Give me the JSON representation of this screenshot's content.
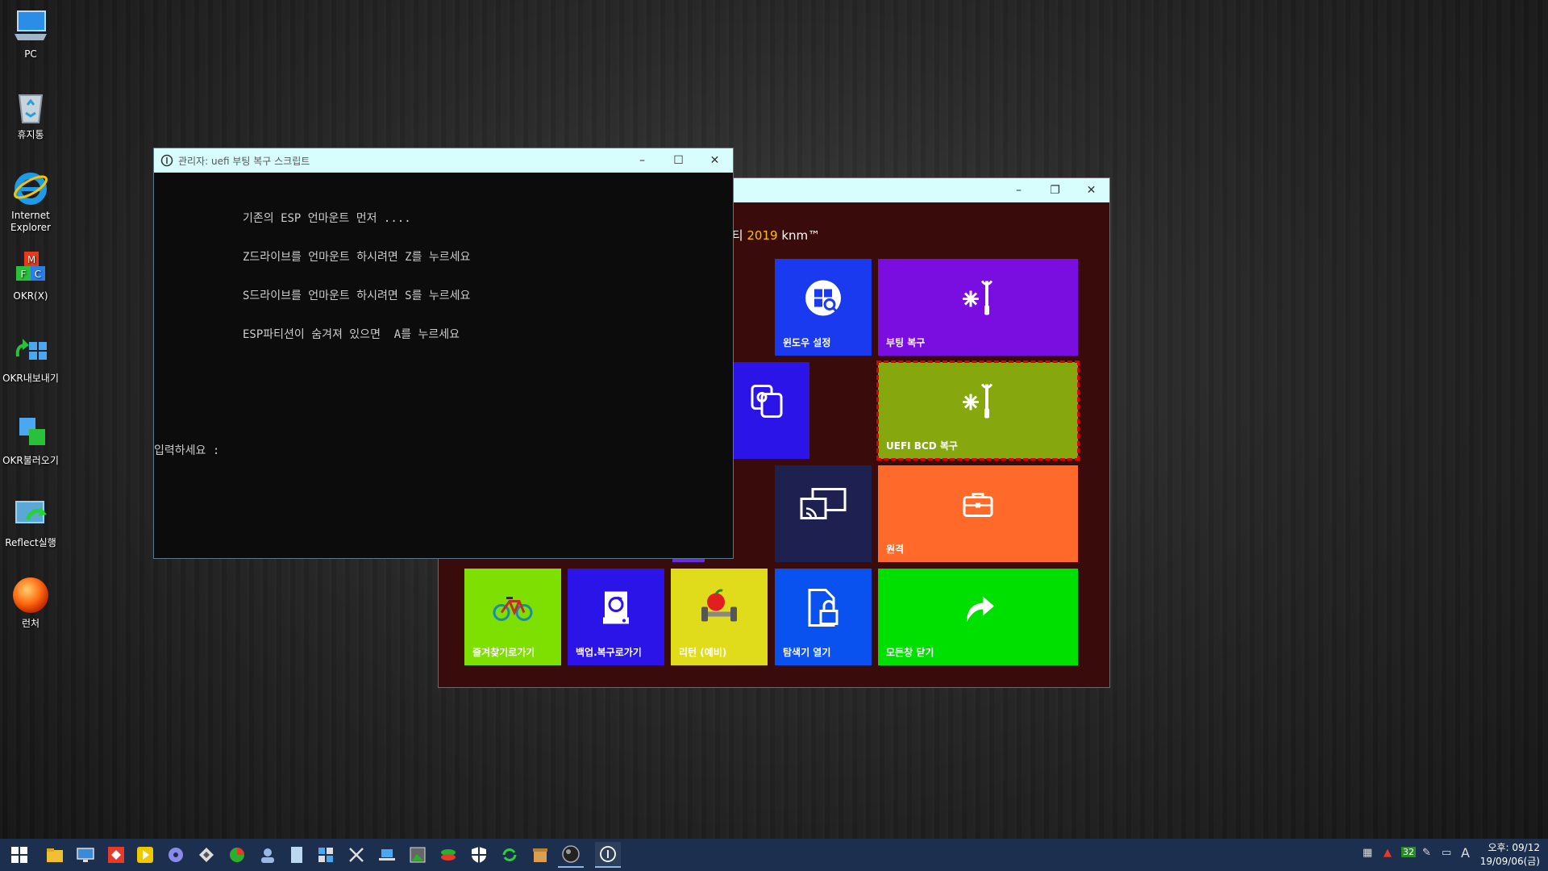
{
  "desktop": {
    "icons": [
      {
        "label": "PC"
      },
      {
        "label": "휴지통"
      },
      {
        "label": "Internet Explorer"
      },
      {
        "label": "OKR(X)"
      },
      {
        "label": "OKR내보내기"
      },
      {
        "label": "OKR불러오기"
      },
      {
        "label": "Reflect실행"
      },
      {
        "label": "런처"
      }
    ]
  },
  "utility_window": {
    "subtitle_prefix": "리티",
    "subtitle_year": "2019",
    "subtitle_suffix": "knm™",
    "tiles": [
      {
        "label": "윈도우 설정",
        "color": "#1a3af0"
      },
      {
        "label": "부팅 복구",
        "color": "#7a0ee0"
      },
      {
        "label": "UEFI BCD 복구",
        "color": "#86a80e"
      },
      {
        "label": "원격",
        "color": "#ff6a2a"
      },
      {
        "label": "즐겨찾기로가기",
        "color": "#7ee000"
      },
      {
        "label": "백업.복구로가기",
        "color": "#2a14e8"
      },
      {
        "label": "리턴 (예비)",
        "color": "#e0dc1c"
      },
      {
        "label": "탐색기 열기",
        "color": "#0a52f0"
      },
      {
        "label": "모든창 닫기",
        "color": "#00e000"
      }
    ]
  },
  "console_window": {
    "title": "관리자:  uefi 부팅 복구 스크립트",
    "lines": [
      "기존의 ESP 언마운트 먼저 ....",
      "Z드라이브를 언마운트 하시려면 Z를 누르세요",
      "S드라이브를 언마운트 하시려면 S를 누르세요",
      "ESP파티션이 숨겨져 있으면  A를 누르세요"
    ],
    "prompt": "입력하세요 :"
  },
  "taskbar": {
    "tray_number": "32",
    "ime": "A",
    "clock_time": "오후: 09/12",
    "clock_date": "19/09/06(금)"
  },
  "colors": {
    "titlebar": "#d8fdfd",
    "util_bg": "#3a0b0b",
    "taskbar": "#1d2f4e",
    "selection_border": "#e00000"
  }
}
